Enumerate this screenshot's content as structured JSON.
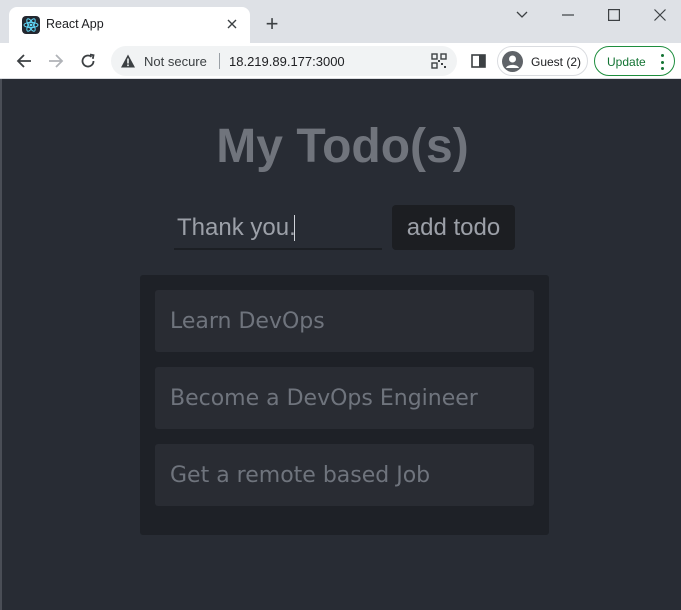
{
  "browser": {
    "tab": {
      "title": "React App",
      "favicon": "react-logo-icon"
    },
    "new_tab": "+",
    "window_controls": [
      "chevron-down-icon",
      "minimize-icon",
      "maximize-icon",
      "close-icon"
    ],
    "address_bar": {
      "security_label": "Not secure",
      "url": "18.219.89.177:3000"
    },
    "profile": {
      "label": "Guest (2)"
    },
    "update_button": {
      "label": "Update"
    }
  },
  "app": {
    "title": "My Todo(s)",
    "input": {
      "value": "Thank you."
    },
    "add_button": {
      "label": "add todo"
    },
    "todos": [
      {
        "text": "Learn DevOps"
      },
      {
        "text": "Become a DevOps Engineer"
      },
      {
        "text": "Get a remote based Job"
      }
    ]
  },
  "colors": {
    "page_background": "#282c34",
    "list_background": "#1e2127",
    "item_background": "#292c33",
    "title_text": "#70747c",
    "update_green": "#137333"
  }
}
